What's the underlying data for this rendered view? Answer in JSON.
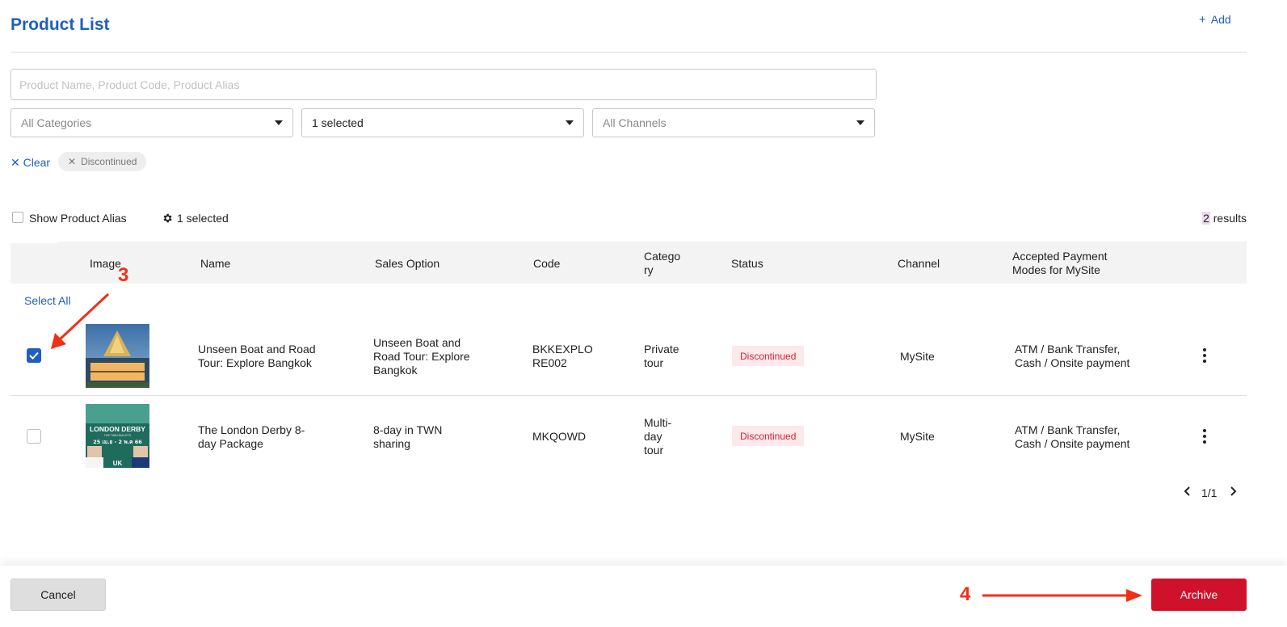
{
  "header": {
    "title": "Product List",
    "add_label": "Add"
  },
  "search": {
    "placeholder": "Product Name, Product Code, Product Alias",
    "value": ""
  },
  "filters": {
    "category": {
      "value": "All Categories"
    },
    "status": {
      "value": "1 selected"
    },
    "channel": {
      "value": "All Channels"
    }
  },
  "active_filters": {
    "clear_label": "Clear",
    "chips": [
      "Discontinued"
    ]
  },
  "toolbar": {
    "show_alias_label": "Show Product Alias",
    "show_alias_checked": false,
    "columns_selected_label": "1 selected",
    "results_count": "2",
    "results_label": "results"
  },
  "table": {
    "columns": {
      "image": "Image",
      "name": "Name",
      "sales_option": "Sales Option",
      "code": "Code",
      "category_l1": "Catego",
      "category_l2": "ry",
      "status": "Status",
      "channel": "Channel",
      "payment_l1": "Accepted Payment",
      "payment_l2": "Modes for MySite"
    },
    "select_all_label": "Select All",
    "rows": [
      {
        "checked": true,
        "name_l1": "Unseen Boat and Road",
        "name_l2": "Tour: Explore Bangkok",
        "sales_l1": "Unseen Boat and",
        "sales_l2": "Road Tour: Explore",
        "sales_l3": "Bangkok",
        "code_l1": "BKKEXPLO",
        "code_l2": "RE002",
        "cat_l1": "Private",
        "cat_l2": "tour",
        "status": "Discontinued",
        "channel": "MySite",
        "payment_l1": "ATM / Bank Transfer,",
        "payment_l2": "Cash / Onsite payment"
      },
      {
        "checked": false,
        "name_l1": "The London Derby 8-",
        "name_l2": "day Package",
        "sales_l1": "8-day in TWN",
        "sales_l2": "sharing",
        "code_l1": "MKQOWD",
        "cat_l1": "Multi-",
        "cat_l2": "day",
        "cat_l3": "tour",
        "status": "Discontinued",
        "channel": "MySite",
        "payment_l1": "ATM / Bank Transfer,",
        "payment_l2": "Cash / Onsite payment",
        "thumb_text": {
          "t1": "LONDON DERBY",
          "t2": "THE TWIN BULLETS",
          "t3": "25 เม.ย - 2 พ.ค 66",
          "t4": "UK"
        }
      }
    ]
  },
  "pagination": {
    "label": "1/1"
  },
  "footer": {
    "cancel_label": "Cancel",
    "archive_label": "Archive"
  },
  "annotations": {
    "step3": "3",
    "step4": "4"
  },
  "colors": {
    "accent": "#1f5fbf",
    "danger": "#d0112b",
    "badge_bg": "#fde8ea",
    "annotation": "#f03018"
  },
  "icons": [
    "plus-icon",
    "caret-down-icon",
    "close-icon",
    "gear-icon",
    "check-icon",
    "kebab-icon",
    "chevron-left-icon",
    "chevron-right-icon"
  ]
}
